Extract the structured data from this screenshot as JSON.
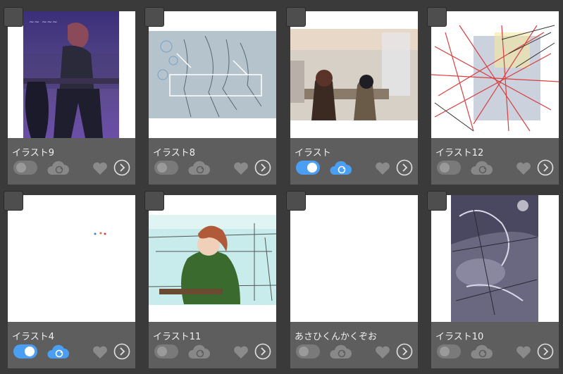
{
  "colors": {
    "background": "#3a3a3a",
    "card": "#5e5e5e",
    "toggle_on": "#4a9ff5",
    "toggle_off": "#7a7a7a"
  },
  "illustrations": [
    {
      "title": "イラスト9",
      "sync_enabled": false,
      "cloud_active": false
    },
    {
      "title": "イラスト8",
      "sync_enabled": false,
      "cloud_active": false
    },
    {
      "title": "イラスト",
      "sync_enabled": true,
      "cloud_active": true
    },
    {
      "title": "イラスト12",
      "sync_enabled": false,
      "cloud_active": false
    },
    {
      "title": "イラスト4",
      "sync_enabled": true,
      "cloud_active": true
    },
    {
      "title": "イラスト11",
      "sync_enabled": false,
      "cloud_active": false
    },
    {
      "title": "あさひくんかくぞお",
      "sync_enabled": false,
      "cloud_active": false
    },
    {
      "title": "イラスト10",
      "sync_enabled": false,
      "cloud_active": false
    }
  ],
  "icons": {
    "select": "checkbox-icon",
    "sync": "toggle-switch",
    "cloud": "cloud-sync-icon",
    "favorite": "heart-icon",
    "detail": "chevron-right-circle-icon"
  }
}
